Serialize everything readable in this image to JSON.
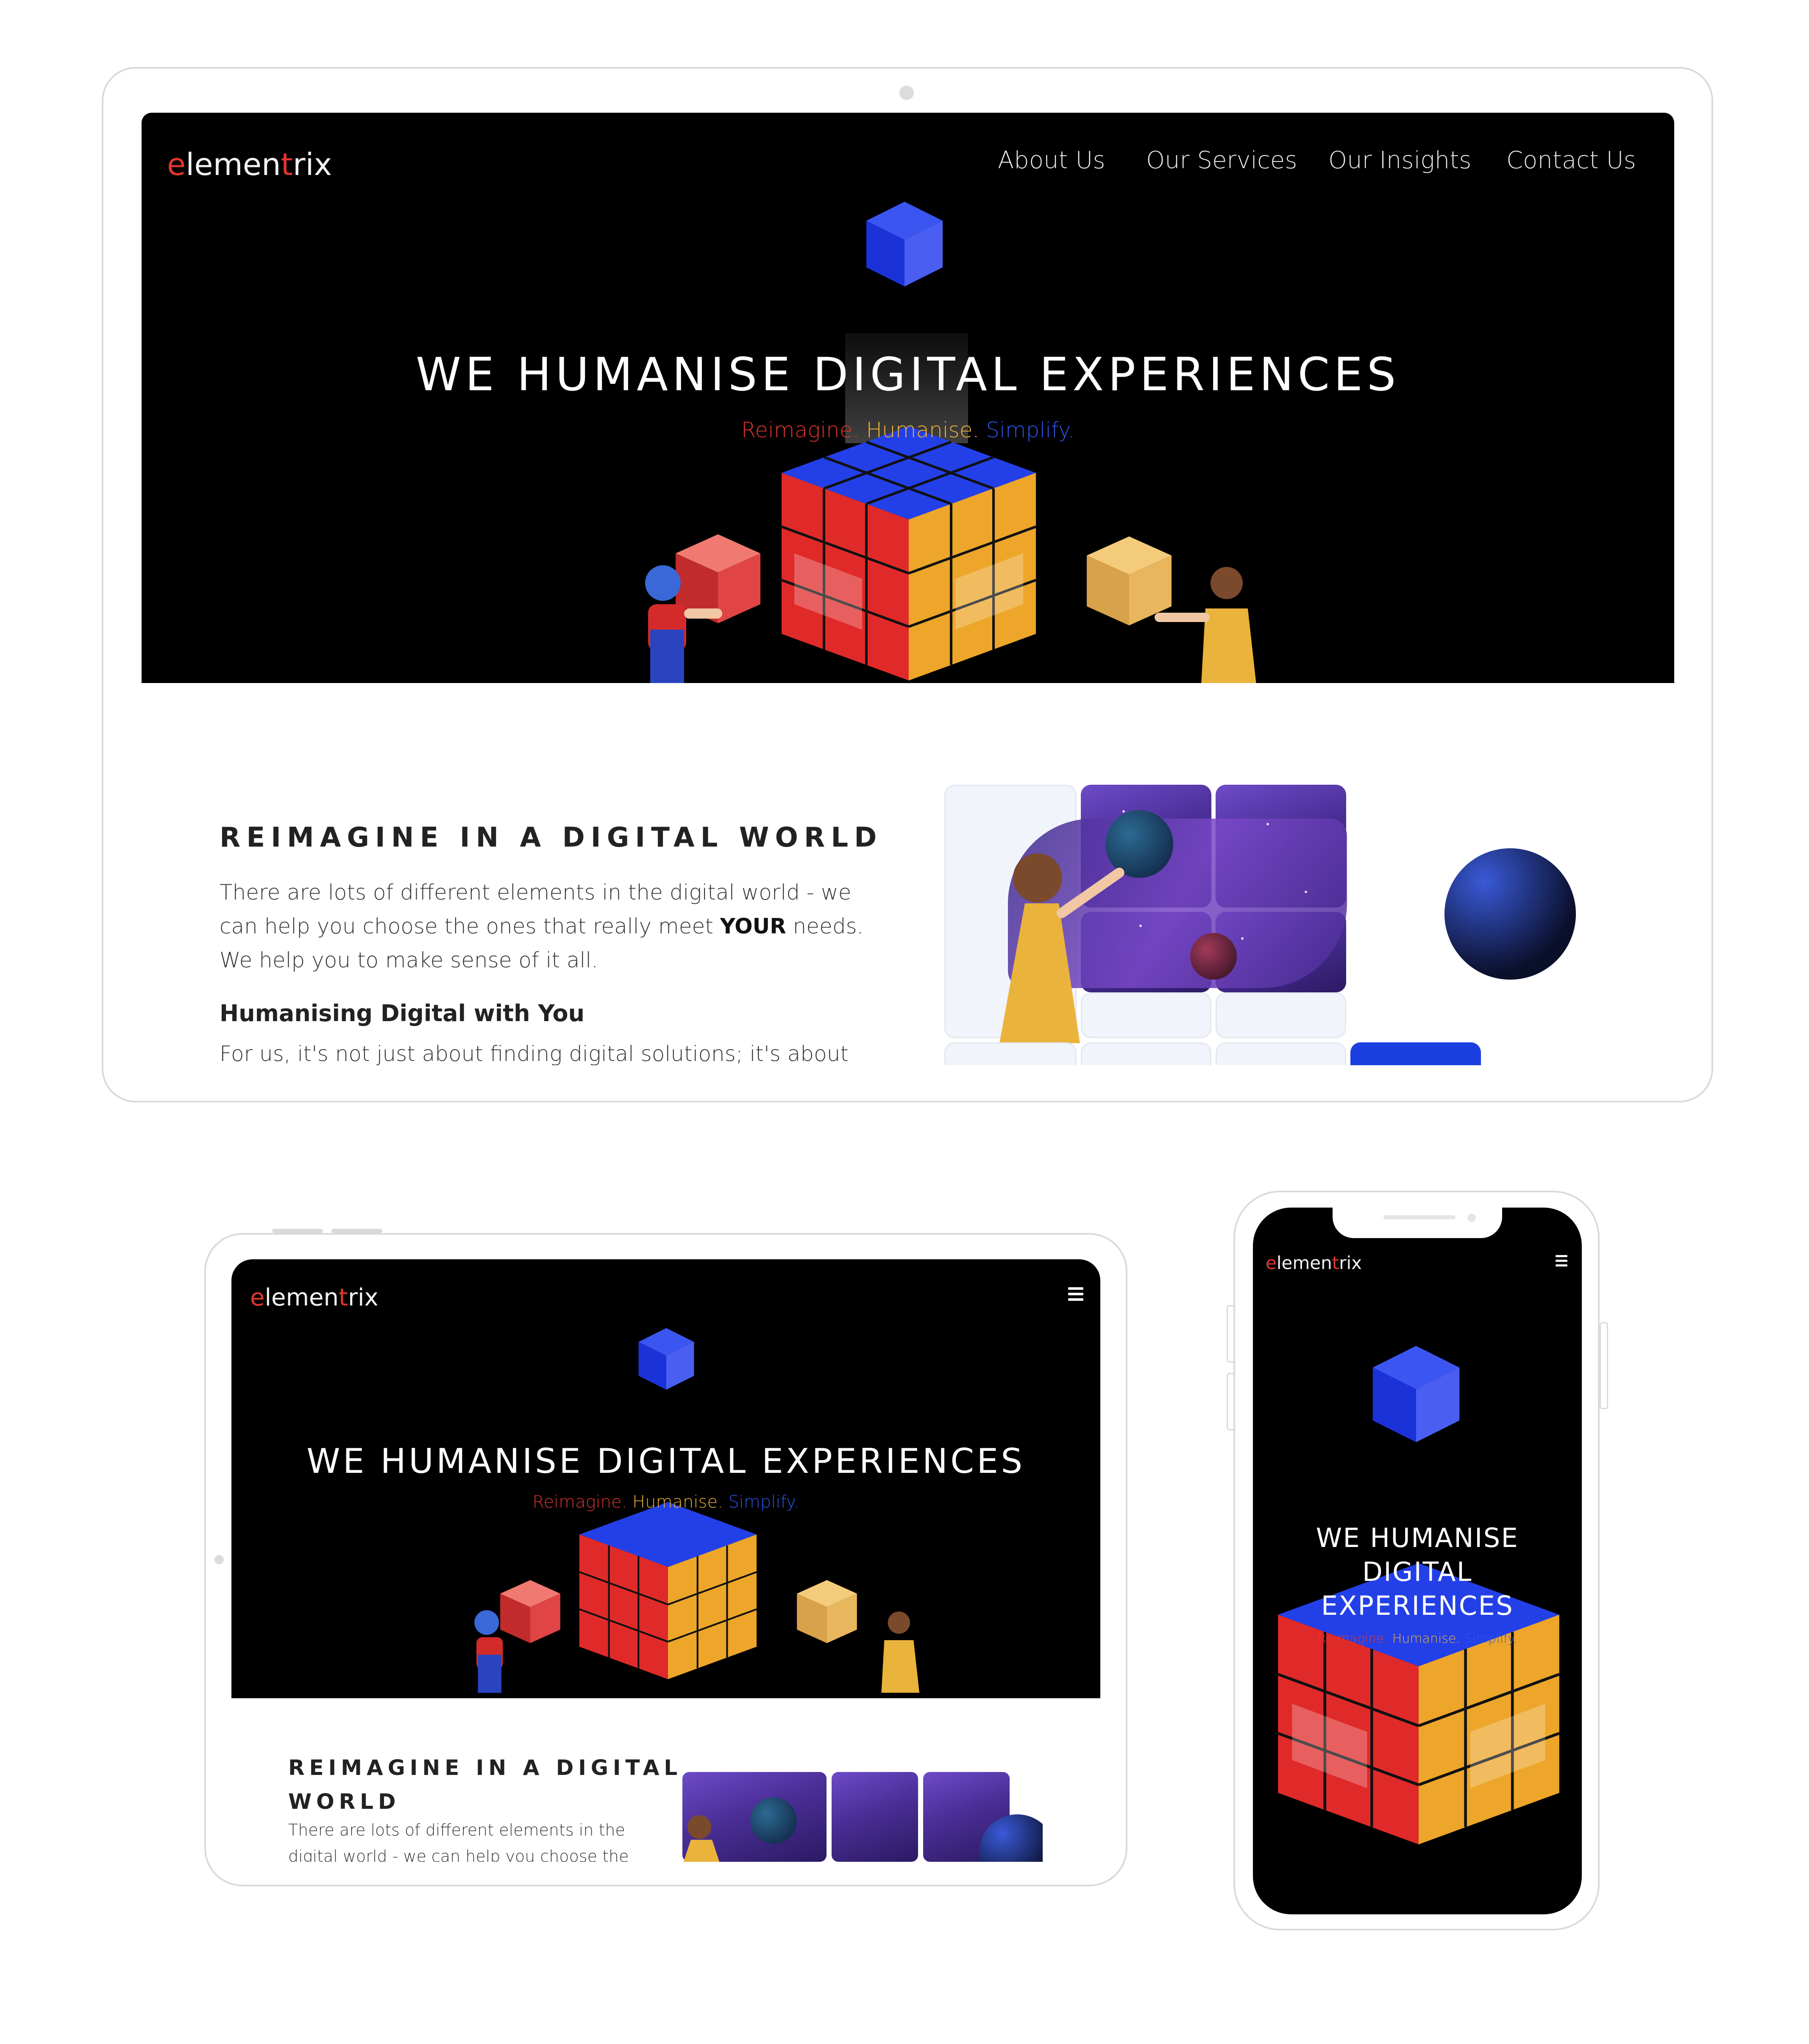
{
  "brand": {
    "logo_e": "e",
    "logo_mid": "lemen",
    "logo_t": "t",
    "logo_end": "rix"
  },
  "nav": {
    "items": [
      "About Us",
      "Our Services",
      "Our Insights",
      "Contact Us"
    ]
  },
  "hero": {
    "title": "WE HUMANISE DIGITAL EXPERIENCES",
    "title_mobile_line1": "WE HUMANISE",
    "title_mobile_line2": "DIGITAL",
    "title_mobile_line3": "EXPERIENCES",
    "tag_reimagine": "Reimagine.",
    "tag_humanise": "Humanise.",
    "tag_simplify": "Simplify."
  },
  "section": {
    "title": "REIMAGINE IN A DIGITAL WORLD",
    "title_tablet_line1": "REIMAGINE IN A DIGITAL",
    "title_tablet_line2": "WORLD",
    "para_line1": "There are lots of different elements in the digital world - we",
    "para_line2_pre": "can help you choose the ones that really meet ",
    "para_line2_bold": "YOUR",
    "para_line2_post": " needs.",
    "para_line3": "We help you to make sense of it all.",
    "subtitle": "Humanising Digital with You",
    "para2_line1": "For us, it's not just about finding digital solutions; it's about",
    "tablet_para_line1": "There are lots of different elements in the",
    "tablet_para_line2": "digital world - we can help you choose the"
  },
  "icons": {
    "menu": "hamburger-menu-icon"
  },
  "colors": {
    "accent_red": "#e2362c",
    "accent_yellow": "#f0b43a",
    "accent_blue": "#2b59e8",
    "hero_bg": "#000000"
  }
}
